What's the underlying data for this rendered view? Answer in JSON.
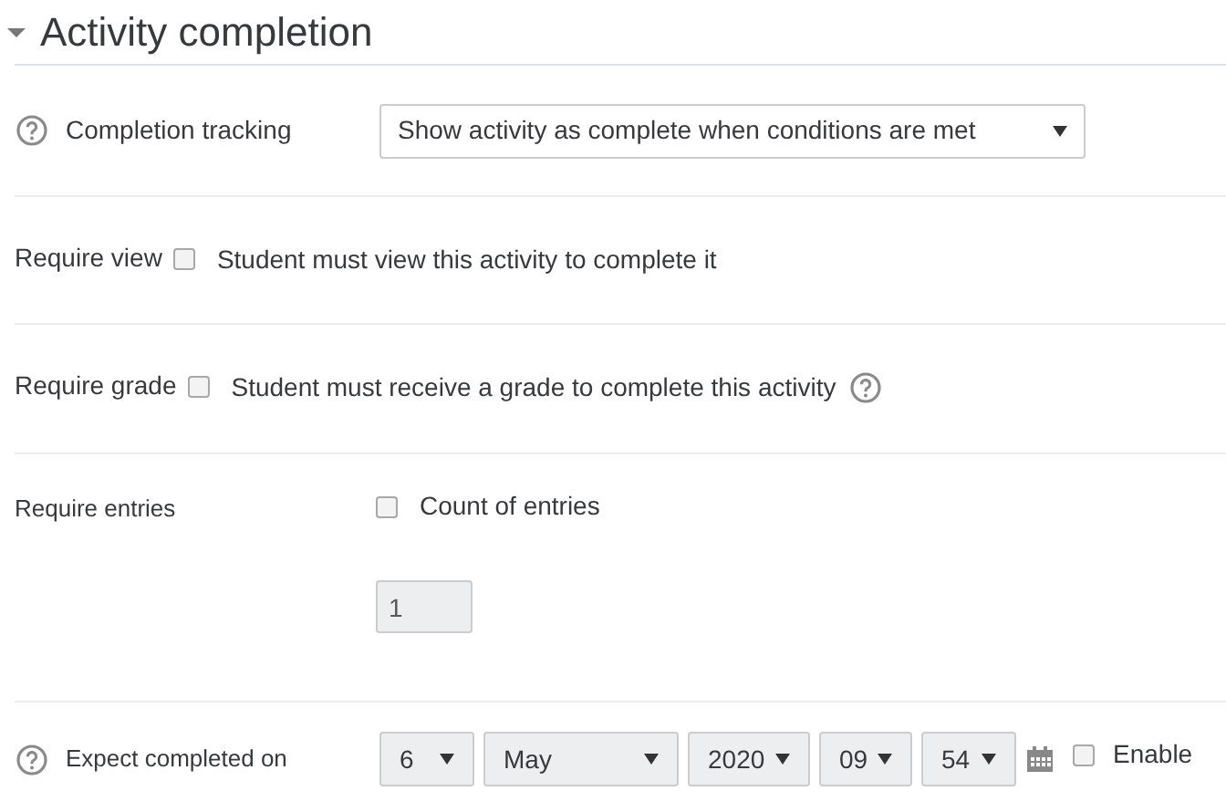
{
  "section": {
    "title": "Activity completion",
    "expanded": true
  },
  "completion_tracking": {
    "label": "Completion tracking",
    "value": "Show activity as complete when conditions are met"
  },
  "require_view": {
    "label": "Require view",
    "checked": false,
    "text": "Student must view this activity to complete it"
  },
  "require_grade": {
    "label": "Require grade",
    "checked": false,
    "text": "Student must receive a grade to complete this activity"
  },
  "require_entries": {
    "label": "Require entries",
    "checked": false,
    "text": "Count of entries",
    "value": "1",
    "disabled": true
  },
  "expect_completed": {
    "label": "Expect completed on",
    "disabled": true,
    "selects": [
      {
        "value": "6"
      },
      {
        "value": "May"
      },
      {
        "value": "2020"
      },
      {
        "value": "09"
      },
      {
        "value": "54"
      }
    ],
    "enable": {
      "label": "Enable",
      "checked": false
    }
  }
}
